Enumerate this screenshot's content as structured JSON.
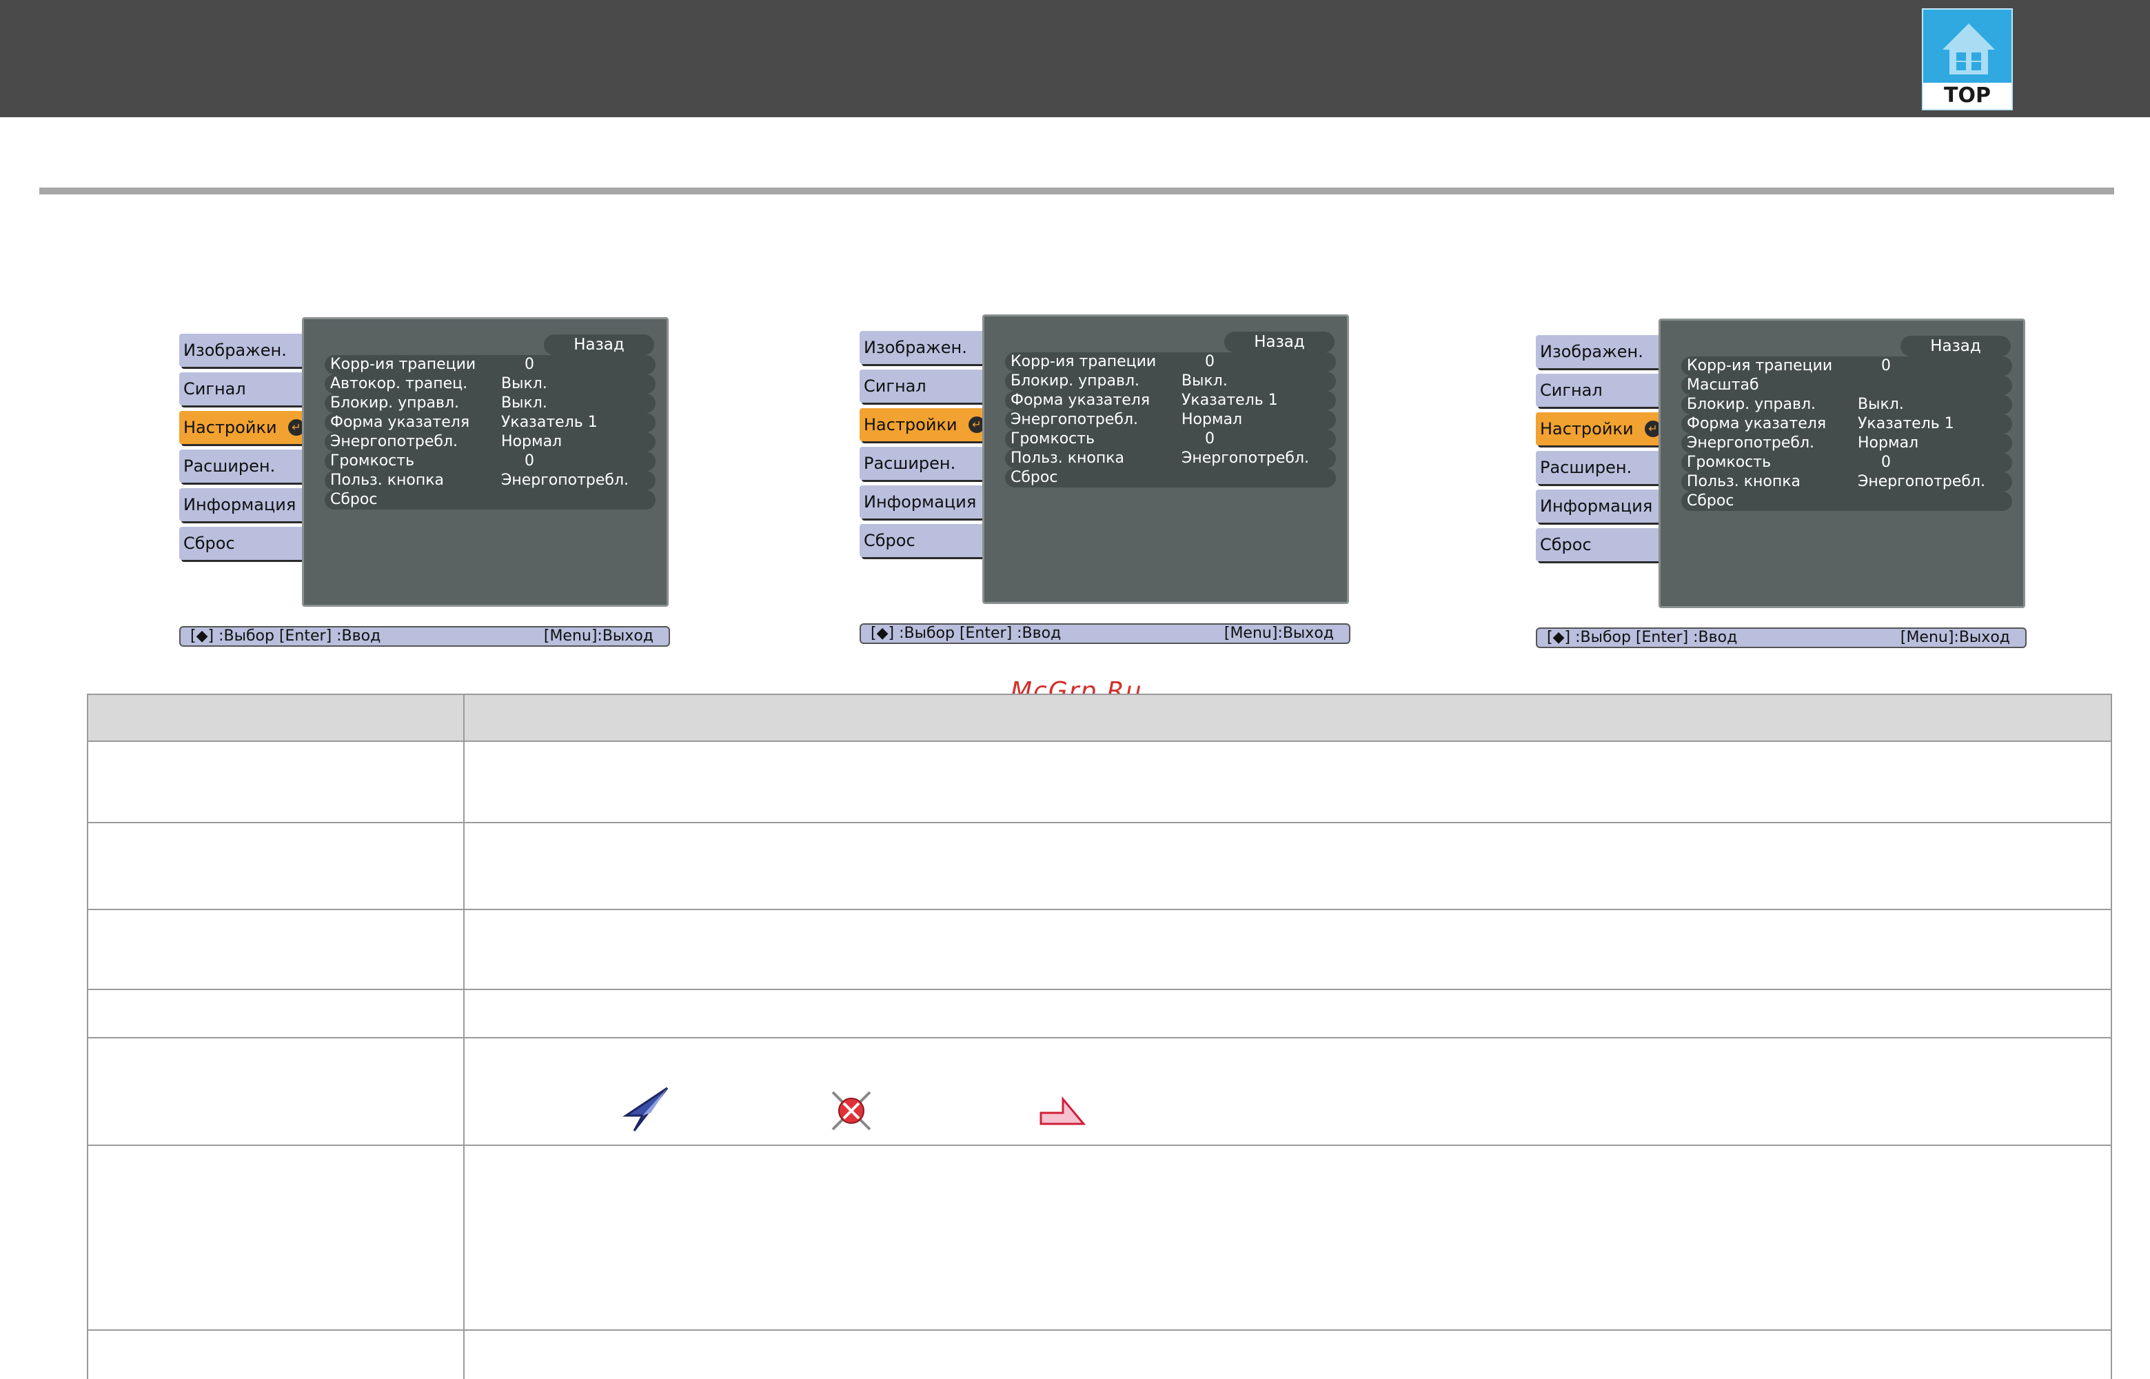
{
  "header": {
    "top_button_label": "TOP",
    "accent_color": "#2fa9e0",
    "icon": "home-icon"
  },
  "menus": [
    {
      "tabs": [
        "Изображен.",
        "Сигнал",
        "Настройки",
        "Расширен.",
        "Информация",
        "Сброс"
      ],
      "active_tab": "Настройки",
      "back_label": "Назад",
      "rows": [
        {
          "label": "Корр-ия трапеции",
          "value": "0"
        },
        {
          "label": "Автокор. трапец.",
          "value": "Выкл."
        },
        {
          "label": "Блокир. управл.",
          "value": "Выкл."
        },
        {
          "label": "Форма указателя",
          "value": "Указатель 1"
        },
        {
          "label": "Энергопотребл.",
          "value": "Нормал"
        },
        {
          "label": "Громкость",
          "value": "0"
        },
        {
          "label": "Польз. кнопка",
          "value": "Энергопотребл."
        },
        {
          "label": "Сброс",
          "value": ""
        }
      ],
      "status": {
        "left": "[◆] :Выбор  [Enter] :Ввод",
        "right": "[Menu]:Выход"
      }
    },
    {
      "tabs": [
        "Изображен.",
        "Сигнал",
        "Настройки",
        "Расширен.",
        "Информация",
        "Сброс"
      ],
      "active_tab": "Настройки",
      "back_label": "Назад",
      "rows": [
        {
          "label": "Корр-ия трапеции",
          "value": "0"
        },
        {
          "label": "Блокир. управл.",
          "value": "Выкл."
        },
        {
          "label": "Форма указателя",
          "value": "Указатель 1"
        },
        {
          "label": "Энергопотребл.",
          "value": "Нормал"
        },
        {
          "label": "Громкость",
          "value": "0"
        },
        {
          "label": "Польз. кнопка",
          "value": "Энергопотребл."
        },
        {
          "label": "Сброс",
          "value": ""
        }
      ],
      "status": {
        "left": "[◆] :Выбор  [Enter] :Ввод",
        "right": "[Menu]:Выход"
      }
    },
    {
      "tabs": [
        "Изображен.",
        "Сигнал",
        "Настройки",
        "Расширен.",
        "Информация",
        "Сброс"
      ],
      "active_tab": "Настройки",
      "back_label": "Назад",
      "rows": [
        {
          "label": "Корр-ия трапеции",
          "value": "0"
        },
        {
          "label": "Масштаб",
          "value": ""
        },
        {
          "label": "Блокир. управл.",
          "value": "Выкл."
        },
        {
          "label": "Форма указателя",
          "value": "Указатель 1"
        },
        {
          "label": "Энергопотребл.",
          "value": "Нормал"
        },
        {
          "label": "Громкость",
          "value": "0"
        },
        {
          "label": "Польз. кнопка",
          "value": "Энергопотребл."
        },
        {
          "label": "Сброс",
          "value": ""
        }
      ],
      "status": {
        "left": "[◆] :Выбор  [Enter] :Ввод",
        "right": "[Menu]:Выход"
      }
    }
  ],
  "watermark": "McGrp.Ru",
  "pointer_icons": [
    "arrow-pointer-icon",
    "target-pointer-icon",
    "hand-pointer-icon"
  ]
}
